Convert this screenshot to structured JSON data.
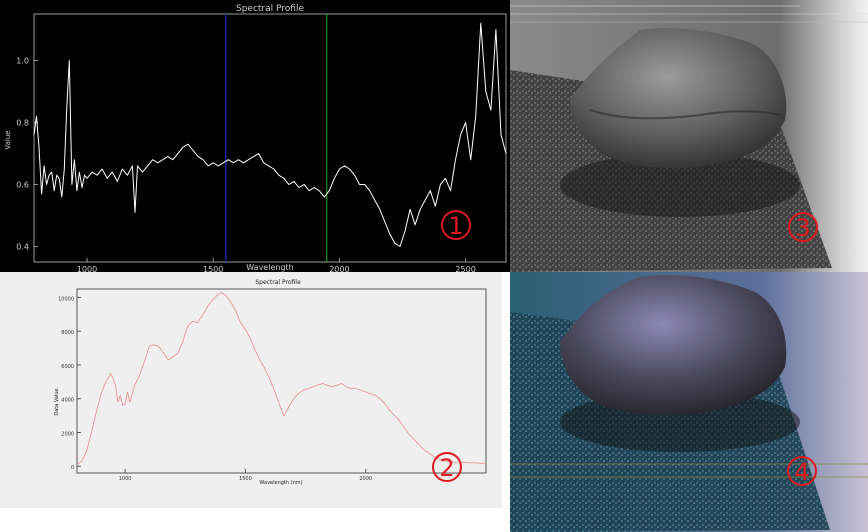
{
  "chart_data": [
    {
      "type": "line",
      "title": "Spectral Profile",
      "xlabel": "Wavelength",
      "ylabel": "Value",
      "xlim": [
        790,
        2660
      ],
      "ylim": [
        0.35,
        1.15
      ],
      "x_ticks": [
        1000,
        1500,
        2000,
        2500
      ],
      "y_ticks": [
        0.4,
        0.6,
        0.8,
        1.0
      ],
      "grid": false,
      "vertical_markers": [
        {
          "x": 1550,
          "color": "#1a3cff"
        },
        {
          "x": 1950,
          "color": "#21b321"
        }
      ],
      "series": [
        {
          "x": [
            790,
            800,
            810,
            820,
            830,
            840,
            850,
            860,
            870,
            880,
            890,
            900,
            910,
            920,
            930,
            940,
            950,
            960,
            970,
            980,
            990,
            1000,
            1020,
            1040,
            1060,
            1080,
            1100,
            1120,
            1140,
            1160,
            1180,
            1190,
            1200,
            1220,
            1240,
            1260,
            1280,
            1300,
            1320,
            1340,
            1360,
            1380,
            1400,
            1420,
            1440,
            1460,
            1480,
            1500,
            1520,
            1540,
            1560,
            1580,
            1600,
            1620,
            1640,
            1660,
            1680,
            1700,
            1720,
            1740,
            1760,
            1780,
            1800,
            1820,
            1840,
            1860,
            1880,
            1900,
            1920,
            1940,
            1960,
            1980,
            2000,
            2020,
            2040,
            2060,
            2080,
            2100,
            2120,
            2140,
            2160,
            2180,
            2200,
            2220,
            2240,
            2260,
            2280,
            2300,
            2320,
            2340,
            2360,
            2380,
            2400,
            2420,
            2440,
            2460,
            2480,
            2500,
            2520,
            2540,
            2560,
            2580,
            2600,
            2620,
            2640,
            2660
          ],
          "y": [
            0.76,
            0.82,
            0.72,
            0.57,
            0.66,
            0.6,
            0.63,
            0.64,
            0.58,
            0.63,
            0.62,
            0.56,
            0.65,
            0.85,
            1.0,
            0.6,
            0.68,
            0.58,
            0.64,
            0.59,
            0.63,
            0.62,
            0.64,
            0.63,
            0.65,
            0.62,
            0.64,
            0.61,
            0.65,
            0.63,
            0.66,
            0.51,
            0.66,
            0.64,
            0.66,
            0.68,
            0.67,
            0.68,
            0.69,
            0.68,
            0.7,
            0.72,
            0.73,
            0.71,
            0.69,
            0.68,
            0.66,
            0.67,
            0.66,
            0.67,
            0.68,
            0.67,
            0.68,
            0.67,
            0.68,
            0.69,
            0.7,
            0.67,
            0.66,
            0.65,
            0.63,
            0.62,
            0.6,
            0.61,
            0.59,
            0.6,
            0.58,
            0.59,
            0.58,
            0.56,
            0.58,
            0.62,
            0.65,
            0.66,
            0.65,
            0.63,
            0.6,
            0.6,
            0.58,
            0.55,
            0.52,
            0.48,
            0.44,
            0.41,
            0.4,
            0.45,
            0.52,
            0.47,
            0.52,
            0.55,
            0.58,
            0.53,
            0.6,
            0.62,
            0.58,
            0.68,
            0.76,
            0.8,
            0.68,
            0.82,
            1.12,
            0.9,
            0.84,
            1.1,
            0.76,
            0.7
          ]
        }
      ],
      "annotation": "1"
    },
    {
      "type": "line",
      "title": "Spectral Profile",
      "xlabel": "Wavelength (nm)",
      "ylabel": "Data Value",
      "xlim": [
        800,
        2500
      ],
      "ylim": [
        -400,
        10500
      ],
      "x_ticks": [
        1000,
        1500,
        2000
      ],
      "y_ticks": [
        0,
        2000,
        4000,
        6000,
        8000,
        10000
      ],
      "grid": false,
      "series": [
        {
          "color": "#e98a8a",
          "x": [
            800,
            820,
            840,
            860,
            880,
            900,
            920,
            940,
            960,
            970,
            980,
            990,
            1000,
            1010,
            1020,
            1040,
            1060,
            1080,
            1100,
            1120,
            1140,
            1160,
            1180,
            1200,
            1220,
            1240,
            1260,
            1280,
            1300,
            1320,
            1340,
            1360,
            1380,
            1400,
            1420,
            1440,
            1460,
            1480,
            1500,
            1520,
            1540,
            1560,
            1580,
            1600,
            1620,
            1640,
            1660,
            1680,
            1700,
            1720,
            1740,
            1760,
            1780,
            1800,
            1820,
            1840,
            1860,
            1880,
            1900,
            1920,
            1940,
            1960,
            1980,
            2000,
            2020,
            2040,
            2060,
            2080,
            2100,
            2120,
            2140,
            2160,
            2180,
            2200,
            2220,
            2240,
            2260,
            2280,
            2300,
            2320,
            2340,
            2360,
            2380,
            2400,
            2420,
            2440,
            2460,
            2480,
            2500
          ],
          "y": [
            100,
            300,
            900,
            2000,
            3200,
            4300,
            5000,
            5500,
            4800,
            3800,
            4200,
            3600,
            3700,
            4400,
            3800,
            4800,
            5400,
            6200,
            7100,
            7200,
            7100,
            6700,
            6300,
            6500,
            6700,
            7400,
            8300,
            8600,
            8500,
            8900,
            9400,
            9800,
            10100,
            10300,
            10100,
            9700,
            9200,
            8500,
            8100,
            7600,
            6900,
            6300,
            5800,
            5200,
            4500,
            3700,
            3000,
            3500,
            4000,
            4300,
            4500,
            4600,
            4700,
            4800,
            4900,
            4800,
            4700,
            4800,
            4900,
            4700,
            4600,
            4600,
            4500,
            4400,
            4300,
            4200,
            4000,
            3700,
            3300,
            3000,
            2700,
            2300,
            1900,
            1600,
            1300,
            1000,
            800,
            600,
            450,
            350,
            280,
            250,
            230,
            220,
            210,
            200,
            190,
            180,
            170
          ]
        }
      ],
      "annotation": "2"
    }
  ],
  "photos": [
    {
      "annotation": "3",
      "description_color": "#7a7a7a"
    },
    {
      "annotation": "4",
      "description_color": "#2f5466"
    }
  ]
}
